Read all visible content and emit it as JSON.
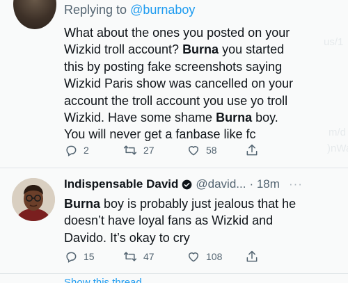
{
  "tweet1": {
    "replying_prefix": "Replying to ",
    "replying_handle": "@burnaboy",
    "body": [
      {
        "text": "What about the ones you posted on your\nWizkid troll account? ",
        "bold": false
      },
      {
        "text": "Burna",
        "bold": true
      },
      {
        "text": " you started\nthis by posting fake screenshots saying\nWizkid Paris show was cancelled on your\naccount the troll account you use yo troll\nWizkid. Have some shame ",
        "bold": false
      },
      {
        "text": "Burna",
        "bold": true
      },
      {
        "text": " boy.\nYou will never get a fanbase like fc",
        "bold": false
      }
    ],
    "replies": "2",
    "retweets": "27",
    "likes": "58"
  },
  "tweet2": {
    "name": "Indispensable David",
    "verified_icon": "verified-badge-icon",
    "handle": "@david...",
    "time": "· 18m",
    "more": "···",
    "body": [
      {
        "text": "Burna",
        "bold": true
      },
      {
        "text": " boy is probably just jealous that he\ndoesn’t have loyal fans as Wizkid and\nDavido. It’s okay to cry",
        "bold": false
      }
    ],
    "replies": "15",
    "retweets": "47",
    "likes": "108"
  },
  "footer": {
    "show_thread": "Show this thread"
  },
  "colors": {
    "accent": "#1d9bf0",
    "secondary_text": "#536471",
    "primary_text": "#0f1419"
  }
}
